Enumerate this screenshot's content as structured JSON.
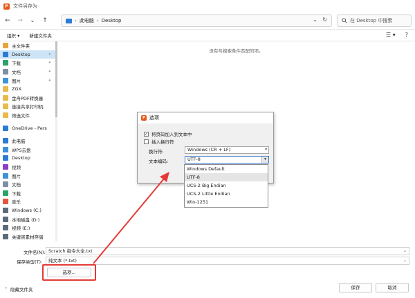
{
  "window": {
    "title": "文件另存为"
  },
  "nav": {
    "back_icon": "←",
    "forward_icon": "→",
    "down_icon": "⌄",
    "up_icon": "↑"
  },
  "address": {
    "crumbs": [
      "此电脑",
      "Desktop"
    ],
    "sep": "›",
    "chev": "⌄",
    "refresh": "↻"
  },
  "search": {
    "placeholder": "在 Desktop 中搜索"
  },
  "cmdbar": {
    "organize": "组织 ▾",
    "new_folder": "新建文件夹",
    "view_icon": "☰ ▾",
    "help_icon": "?"
  },
  "sidebar": {
    "items": [
      {
        "label": "主文件夹",
        "icon": "home-icon",
        "color": "#e8a23a"
      },
      {
        "label": "Desktop",
        "icon": "desktop-icon",
        "color": "#2b7bd6",
        "pinned": true,
        "selected": true
      },
      {
        "label": "下载",
        "icon": "download-icon",
        "color": "#2aa36b",
        "pinned": true
      },
      {
        "label": "文档",
        "icon": "document-icon",
        "color": "#7d8fa3",
        "pinned": true
      },
      {
        "label": "图片",
        "icon": "pictures-icon",
        "color": "#3b94d9",
        "pinned": true
      },
      {
        "label": "ZGX",
        "icon": "folder-icon",
        "color": "#e9b949"
      },
      {
        "label": "金舟PDF转换器",
        "icon": "folder-icon",
        "color": "#e9b949"
      },
      {
        "label": "连接共享打印机",
        "icon": "folder-icon",
        "color": "#e9b949"
      },
      {
        "label": "筛选文件",
        "icon": "folder-icon",
        "color": "#e9b949"
      },
      {
        "gap": true
      },
      {
        "label": "OneDrive - Pers",
        "icon": "cloud-icon",
        "color": "#2b7bd6"
      },
      {
        "gap": true
      },
      {
        "label": "此电脑",
        "icon": "pc-icon",
        "color": "#2b7bd6"
      },
      {
        "label": "WPS云盘",
        "icon": "cloud-icon",
        "color": "#3a8fe0"
      },
      {
        "label": "Desktop",
        "icon": "desktop-icon",
        "color": "#2b7bd6"
      },
      {
        "label": "视频",
        "icon": "video-icon",
        "color": "#8b3fc9"
      },
      {
        "label": "图片",
        "icon": "pictures-icon",
        "color": "#3b94d9"
      },
      {
        "label": "文档",
        "icon": "document-icon",
        "color": "#7d8fa3"
      },
      {
        "label": "下载",
        "icon": "download-icon",
        "color": "#2aa36b"
      },
      {
        "label": "音乐",
        "icon": "music-icon",
        "color": "#e5543b"
      },
      {
        "label": "Windows (C:)",
        "icon": "drive-icon",
        "color": "#5a6b7a"
      },
      {
        "label": "本地磁盘 (D:)",
        "icon": "drive-icon",
        "color": "#5a6b7a"
      },
      {
        "label": "视频 (E:)",
        "icon": "drive-icon",
        "color": "#5a6b7a"
      },
      {
        "label": "关键资素材存储",
        "icon": "drive-icon",
        "color": "#5a6b7a"
      }
    ],
    "pin_glyph": "✦"
  },
  "main": {
    "empty_message": "没有与搜索条件匹配的项。"
  },
  "bottom": {
    "filename_label": "文件名(N):",
    "filename_value": "Scratch 指令大全.txt",
    "type_label": "保存类型(T):",
    "type_value": "纯文本 (*.txt)",
    "options_button": "选项...",
    "hide_folders": "隐藏文件夹",
    "save_button": "保存",
    "cancel_button": "取消"
  },
  "dialog": {
    "title": "选项",
    "check1": "将页码加入到文本中",
    "check1_mark": "✓",
    "check2": "插入换行符",
    "line_break_label": "换行符:",
    "line_break_value": "Windows (CR + LF)",
    "encoding_label": "文本编码:",
    "encoding_value": "UTF-8",
    "encoding_options": [
      "Windows Default",
      "UTF-8",
      "UCS-2 Big Endian",
      "UCS-2 Little Endian",
      "Win-1251"
    ],
    "selected_option": 1
  },
  "annotation_color": "#e53935"
}
